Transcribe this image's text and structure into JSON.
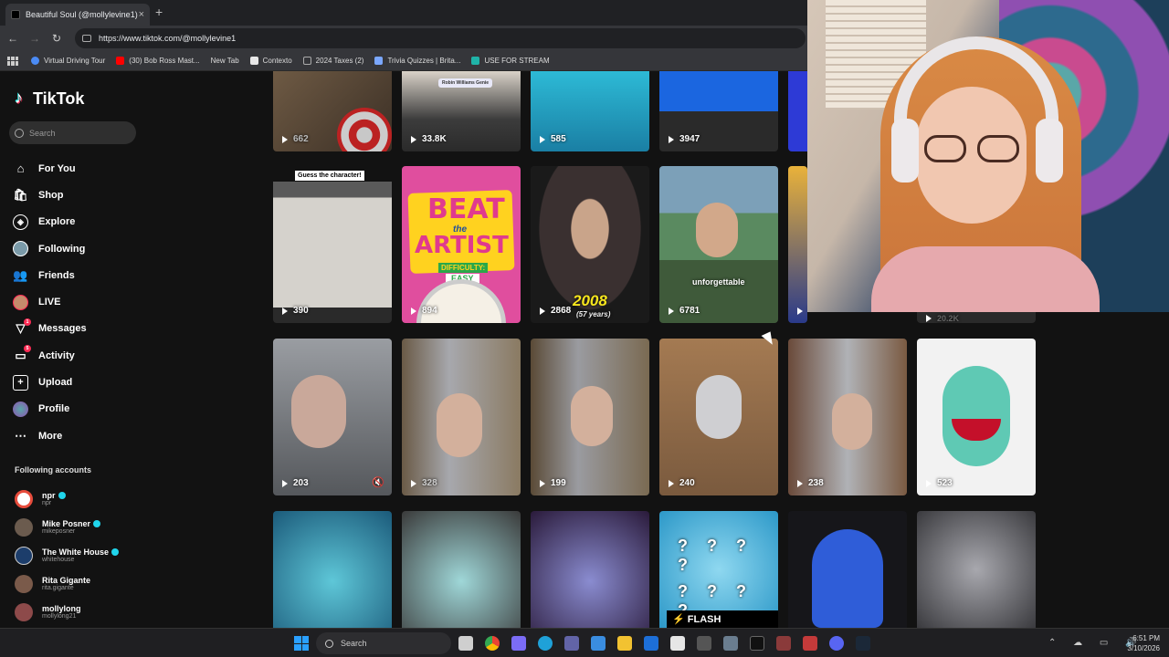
{
  "browser": {
    "tab_title": "Beautiful Soul (@mollylevine1)",
    "tab_close": "×",
    "new_tab": "+",
    "url": "https://www.tiktok.com/@mollylevine1",
    "nav": {
      "back": "←",
      "forward": "→",
      "reload": "↻"
    },
    "bookmarks": [
      {
        "label": "Virtual Driving Tour",
        "color": "#4b8bf5"
      },
      {
        "label": "(30) Bob Ross Mast...",
        "color": "#ff0000"
      },
      {
        "label": "New Tab",
        "color": "#35363a"
      },
      {
        "label": "Contexto",
        "color": "#e8e8e8"
      },
      {
        "label": "2024 Taxes (2)",
        "color": "#9aa0a6"
      },
      {
        "label": "Trivia Quizzes | Brita...",
        "color": "#7aa7ff"
      },
      {
        "label": "USE FOR STREAM",
        "color": "#1fb3a8"
      }
    ]
  },
  "sidebar": {
    "brand": "TikTok",
    "search_placeholder": "Search",
    "menu": [
      {
        "label": "For You",
        "icon": "home-icon"
      },
      {
        "label": "Shop",
        "icon": "shop-icon"
      },
      {
        "label": "Explore",
        "icon": "compass-icon"
      },
      {
        "label": "Following",
        "icon": "avatar-icon"
      },
      {
        "label": "Friends",
        "icon": "friends-icon"
      },
      {
        "label": "LIVE",
        "icon": "live-avatar-icon"
      },
      {
        "label": "Messages",
        "icon": "messages-icon",
        "badge": "1"
      },
      {
        "label": "Activity",
        "icon": "activity-icon",
        "badge": "5"
      },
      {
        "label": "Upload",
        "icon": "upload-icon"
      },
      {
        "label": "Profile",
        "icon": "profile-avatar-icon"
      },
      {
        "label": "More",
        "icon": "more-icon"
      }
    ],
    "following_header": "Following accounts",
    "accounts": [
      {
        "name": "npr",
        "handle": "npr",
        "verified": true,
        "color": "#ffffff"
      },
      {
        "name": "Mike Posner",
        "handle": "mikeposner",
        "verified": true,
        "color": "#6b5b4e"
      },
      {
        "name": "The White House",
        "handle": "whitehouse",
        "verified": true,
        "color": "#1c3d6b"
      },
      {
        "name": "Rita Gigante",
        "handle": "rita.gigante",
        "verified": false,
        "color": "#7a5a4a"
      },
      {
        "name": "mollylong",
        "handle": "mollylong21",
        "verified": false,
        "color": "#8d4a4a"
      }
    ]
  },
  "videos": {
    "row1": [
      "662",
      "33.8K",
      "585",
      "3947"
    ],
    "row2": [
      "390",
      "894",
      "2868",
      "6781",
      "907",
      "20.2K"
    ],
    "row3": [
      "203",
      "328",
      "199",
      "240",
      "238",
      "523"
    ],
    "captions": {
      "guess": "Guess the character!",
      "beat_the": "BEAT",
      "the_word": "the",
      "artist": "ARTIST",
      "difficulty": "DIFFICULTY:",
      "easy": "EASY",
      "year": "2008",
      "years_ago": "(57 years)",
      "unforgettable": "unforgettable",
      "flash": "⚡ FLASH",
      "question_marks": "? ? ? ?",
      "robin_tag": "Robin Williams Genie"
    }
  },
  "taskbar": {
    "search": "Search",
    "time": "6:51 PM",
    "date": "3/10/2026",
    "tray_icons": "⌃ ☁ ▭ 🔊"
  }
}
